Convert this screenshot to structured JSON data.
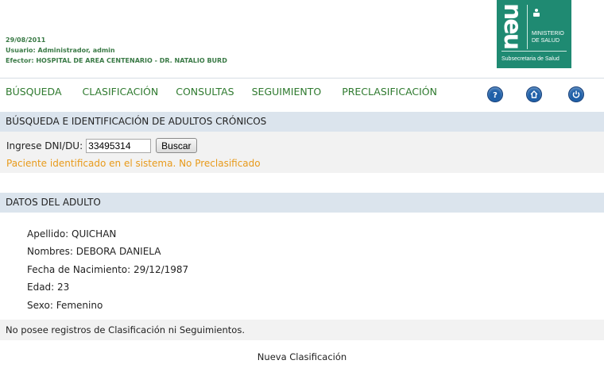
{
  "header": {
    "date": "29/08/2011",
    "user": "Usuario: Administrador, admin",
    "efector": "Efector: HOSPITAL DE AREA CENTENARIO - DR. NATALIO BURD"
  },
  "logo": {
    "brand": "neu",
    "ministry_line1": "MINISTERIO",
    "ministry_line2": "DE SALUD",
    "subsecretaria": "Subsecretaria de Salud",
    "bg_color": "#1f8a72"
  },
  "nav": {
    "items": [
      "BÚSQUEDA",
      "CLASIFICACIÓN",
      "CONSULTAS",
      "SEGUIMIENTO",
      "PRECLASIFICACIÓN"
    ],
    "icons": [
      "help-icon",
      "home-icon",
      "power-icon"
    ],
    "color": "#2f7a2f",
    "icon_color": "#1e5fa8"
  },
  "search_section": {
    "title": "BÚSQUEDA E IDENTIFICACIÓN DE ADULTOS CRÓNICOS",
    "label": "Ingrese DNI/DU:",
    "dni_value": "33495314",
    "button_label": "Buscar",
    "status": "Paciente identificado en el sistema. No Preclasificado",
    "status_color": "#e89a1a"
  },
  "adult_section": {
    "title": "DATOS DEL ADULTO",
    "apellido": "Apellido: QUICHAN",
    "nombres": "Nombres: DEBORA DANIELA",
    "fecha_nacimiento": "Fecha de Nacimiento: 29/12/1987",
    "edad": "Edad: 23",
    "sexo": "Sexo: Femenino"
  },
  "records": {
    "message": "No posee registros de Clasificación ni Seguimientos.",
    "new_link": "Nueva Clasificación"
  }
}
